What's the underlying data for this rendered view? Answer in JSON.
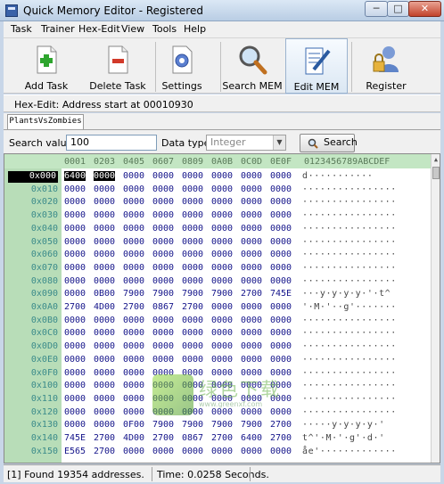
{
  "window": {
    "title": "Quick Memory Editor - Registered",
    "min": "─",
    "max": "□",
    "close": "✕"
  },
  "menu": [
    "Task",
    "Trainer",
    "Hex-Edit",
    "View",
    "Tools",
    "Help"
  ],
  "toolbar": [
    "Add Task",
    "Delete Task",
    "Settings",
    "Search MEM",
    "Edit MEM",
    "Register"
  ],
  "info": "Hex-Edit: Address start at 00010930",
  "tab": "PlantsVsZombies",
  "search": {
    "value_label": "Search value:",
    "value": "100",
    "type_label": "Data type:",
    "type_value": "Integer",
    "button": "Search"
  },
  "hex": {
    "header": [
      "0001",
      "0203",
      "0405",
      "0607",
      "0809",
      "0A0B",
      "0C0D",
      "0E0F"
    ],
    "ascii_header": "0123456789ABCDEF",
    "rows": [
      {
        "addr": "0x000",
        "vals": [
          "6400",
          "0000",
          "0000",
          "0000",
          "0000",
          "0000",
          "0000",
          "0000"
        ],
        "asc": "d···········"
      },
      {
        "addr": "0x010",
        "vals": [
          "0000",
          "0000",
          "0000",
          "0000",
          "0000",
          "0000",
          "0000",
          "0000"
        ],
        "asc": "················"
      },
      {
        "addr": "0x020",
        "vals": [
          "0000",
          "0000",
          "0000",
          "0000",
          "0000",
          "0000",
          "0000",
          "0000"
        ],
        "asc": "················"
      },
      {
        "addr": "0x030",
        "vals": [
          "0000",
          "0000",
          "0000",
          "0000",
          "0000",
          "0000",
          "0000",
          "0000"
        ],
        "asc": "················"
      },
      {
        "addr": "0x040",
        "vals": [
          "0000",
          "0000",
          "0000",
          "0000",
          "0000",
          "0000",
          "0000",
          "0000"
        ],
        "asc": "················"
      },
      {
        "addr": "0x050",
        "vals": [
          "0000",
          "0000",
          "0000",
          "0000",
          "0000",
          "0000",
          "0000",
          "0000"
        ],
        "asc": "················"
      },
      {
        "addr": "0x060",
        "vals": [
          "0000",
          "0000",
          "0000",
          "0000",
          "0000",
          "0000",
          "0000",
          "0000"
        ],
        "asc": "················"
      },
      {
        "addr": "0x070",
        "vals": [
          "0000",
          "0000",
          "0000",
          "0000",
          "0000",
          "0000",
          "0000",
          "0000"
        ],
        "asc": "················"
      },
      {
        "addr": "0x080",
        "vals": [
          "0000",
          "0000",
          "0000",
          "0000",
          "0000",
          "0000",
          "0000",
          "0000"
        ],
        "asc": "················"
      },
      {
        "addr": "0x090",
        "vals": [
          "0000",
          "0B00",
          "7900",
          "7900",
          "7900",
          "7900",
          "2700",
          "745E"
        ],
        "asc": "···y·y·y·y·'·t^"
      },
      {
        "addr": "0x0A0",
        "vals": [
          "2700",
          "4D00",
          "2700",
          "0867",
          "2700",
          "0000",
          "0000",
          "0000"
        ],
        "asc": "'·M·'··g'·······"
      },
      {
        "addr": "0x0B0",
        "vals": [
          "0000",
          "0000",
          "0000",
          "0000",
          "0000",
          "0000",
          "0000",
          "0000"
        ],
        "asc": "················"
      },
      {
        "addr": "0x0C0",
        "vals": [
          "0000",
          "0000",
          "0000",
          "0000",
          "0000",
          "0000",
          "0000",
          "0000"
        ],
        "asc": "················"
      },
      {
        "addr": "0x0D0",
        "vals": [
          "0000",
          "0000",
          "0000",
          "0000",
          "0000",
          "0000",
          "0000",
          "0000"
        ],
        "asc": "················"
      },
      {
        "addr": "0x0E0",
        "vals": [
          "0000",
          "0000",
          "0000",
          "0000",
          "0000",
          "0000",
          "0000",
          "0000"
        ],
        "asc": "················"
      },
      {
        "addr": "0x0F0",
        "vals": [
          "0000",
          "0000",
          "0000",
          "0000",
          "0000",
          "0000",
          "0000",
          "0000"
        ],
        "asc": "················"
      },
      {
        "addr": "0x100",
        "vals": [
          "0000",
          "0000",
          "0000",
          "0000",
          "0000",
          "0000",
          "0000",
          "0000"
        ],
        "asc": "················"
      },
      {
        "addr": "0x110",
        "vals": [
          "0000",
          "0000",
          "0000",
          "0000",
          "0000",
          "0000",
          "0000",
          "0000"
        ],
        "asc": "················"
      },
      {
        "addr": "0x120",
        "vals": [
          "0000",
          "0000",
          "0000",
          "0000",
          "0000",
          "0000",
          "0000",
          "0000"
        ],
        "asc": "················"
      },
      {
        "addr": "0x130",
        "vals": [
          "0000",
          "0000",
          "0F00",
          "7900",
          "7900",
          "7900",
          "7900",
          "2700"
        ],
        "asc": "·····y·y·y·y·'"
      },
      {
        "addr": "0x140",
        "vals": [
          "745E",
          "2700",
          "4D00",
          "2700",
          "0867",
          "2700",
          "6400",
          "2700"
        ],
        "asc": "t^'·M·'·g'·d·'"
      },
      {
        "addr": "0x150",
        "vals": [
          "E565",
          "2700",
          "0000",
          "0000",
          "0000",
          "0000",
          "0000",
          "0000"
        ],
        "asc": "åe'·············"
      }
    ]
  },
  "status": {
    "found": "[1] Found 19354 addresses.",
    "time": "Time:  0.0258 Seconds."
  },
  "watermark": {
    "text": "绿色下载",
    "url": "www.greenxf.com"
  }
}
